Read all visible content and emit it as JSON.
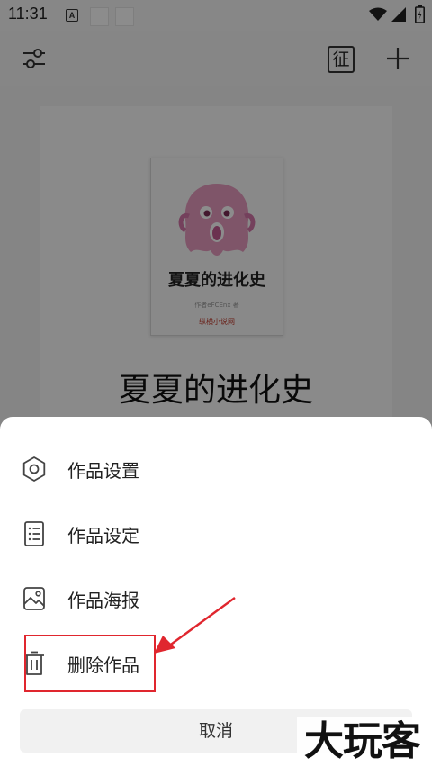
{
  "status_bar": {
    "time": "11:31",
    "notification_letter": "A",
    "icons": [
      "wifi-icon",
      "signal-icon",
      "battery-icon"
    ]
  },
  "toolbar": {
    "left_icon": "filter-settings-icon",
    "right_icons": [
      "征",
      "+"
    ],
    "contest_label": "征"
  },
  "book": {
    "cover_title": "夏夏的进化史",
    "cover_author": "作者eFCEnx 著",
    "cover_publisher": "纵横小说网",
    "title": "夏夏的进化史"
  },
  "sheet": {
    "items": [
      {
        "label": "作品设置",
        "icon": "hexagon-settings-icon"
      },
      {
        "label": "作品设定",
        "icon": "list-document-icon"
      },
      {
        "label": "作品海报",
        "icon": "image-poster-icon"
      },
      {
        "label": "删除作品",
        "icon": "trash-icon"
      }
    ],
    "cancel_label": "取消"
  },
  "annotation": {
    "highlight_color": "#e0262e"
  },
  "watermark": "大玩客"
}
